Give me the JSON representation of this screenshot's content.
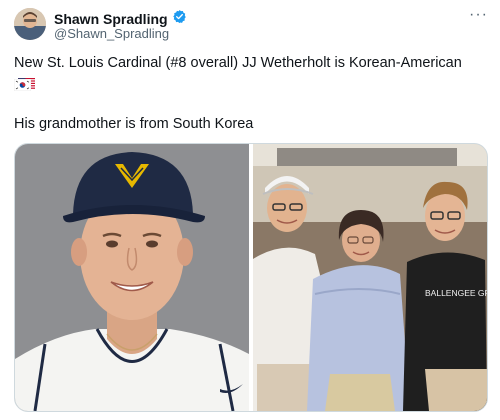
{
  "author": {
    "display_name": "Shawn Spradling",
    "handle": "@Shawn_Spradling",
    "verified": true,
    "avatar_icon": "profile-photo"
  },
  "tweet": {
    "line1": "New St. Louis Cardinal (#8 overall) JJ Wetherholt is Korean-American",
    "line2": "",
    "line3": "His grandmother is from South Korea",
    "flags": [
      "us-flag-icon",
      "south-korea-flag-icon"
    ]
  },
  "media": {
    "left_image": "headshot-wvu-cap",
    "right_image": "family-photo",
    "shirt_text": "BALLENGEE GROUP"
  },
  "colors": {
    "verified_blue": "#1d9bf0",
    "secondary_text": "#536471",
    "cap_navy": "#1f2a44",
    "cap_gold": "#e6b800"
  }
}
